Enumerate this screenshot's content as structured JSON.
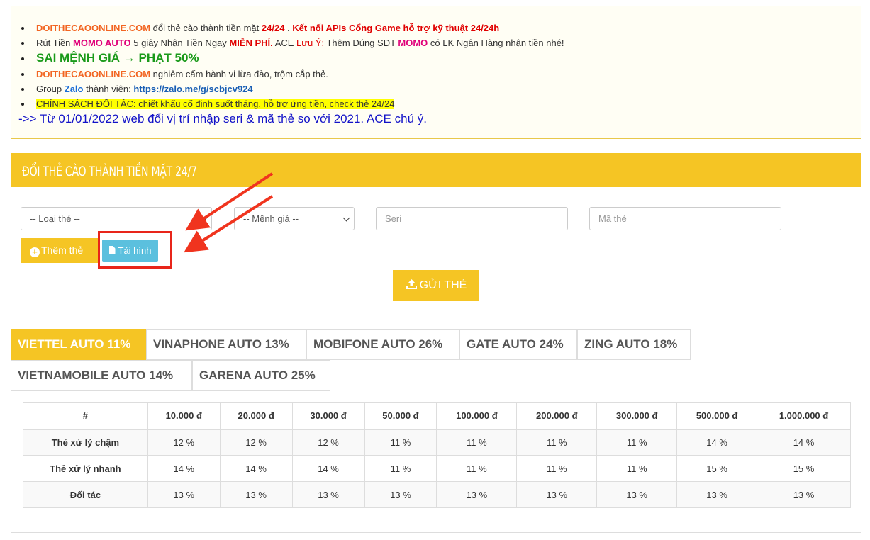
{
  "notice": {
    "line1": {
      "brand": "DOITHECAOONLINE.COM",
      "text1": " đổi thẻ cào thành tiền mặt ",
      "time": "24/24",
      "text2": " . ",
      "apis": "Kết nối APIs Cổng Game hỗ trợ kỹ thuật 24/24h"
    },
    "line2": {
      "text1": "Rút Tiền ",
      "momo": "MOMO AUTO",
      "text2": " 5 giây Nhận Tiền Ngay ",
      "free": "MIỄN PHÍ.",
      "text3": " ACE ",
      "note": "Lưu Ý:",
      "text4": " Thêm Đúng SĐT ",
      "momo2": "MOMO",
      "text5": " có LK Ngân Hàng nhận tiền nhé!"
    },
    "line3": "SAI MỆNH GIÁ → PHẠT 50%",
    "line4": {
      "brand": "DOITHECAOONLINE.COM",
      "text": " nghiêm cấm hành vi lừa đảo, trộm cắp thẻ."
    },
    "line5": {
      "text1": "Group ",
      "zalo": "Zalo",
      "text2": " thành viên: ",
      "link": "https://zalo.me/g/scbjcv924"
    },
    "line6": "CHÍNH SÁCH ĐỐI TÁC: chiết khấu cố định suốt tháng, hỗ trợ ứng tiền, check thẻ 24/24",
    "line7": "->> Từ 01/01/2022 web đổi vị trí nhập seri & mã thẻ so với 2021. ACE chú ý."
  },
  "form": {
    "title": "ĐỔI THẺ CÀO THÀNH TIỀN MẶT 24/7",
    "card_type_placeholder": "-- Loại thẻ --",
    "denomination_placeholder": "-- Mệnh giá --",
    "serial_placeholder": "Seri",
    "code_placeholder": "Mã thẻ",
    "add_label": "Thêm thẻ",
    "upload_label": "Tải hình",
    "send_label": "GỬI THẺ"
  },
  "tabs": [
    {
      "label": "VIETTEL AUTO 11%",
      "active": true
    },
    {
      "label": "VINAPHONE AUTO 13%"
    },
    {
      "label": "MOBIFONE AUTO 26%"
    },
    {
      "label": "GATE AUTO 24%"
    },
    {
      "label": "ZING AUTO 18%"
    },
    {
      "label": "VIETNAMOBILE AUTO 14%"
    },
    {
      "label": "GARENA AUTO 25%"
    }
  ],
  "rate_table": {
    "headers": [
      "#",
      "10.000 đ",
      "20.000 đ",
      "30.000 đ",
      "50.000 đ",
      "100.000 đ",
      "200.000 đ",
      "300.000 đ",
      "500.000 đ",
      "1.000.000 đ"
    ],
    "rows": [
      [
        "Thẻ xử lý chậm",
        "12 %",
        "12 %",
        "12 %",
        "11 %",
        "11 %",
        "11 %",
        "11 %",
        "14 %",
        "14 %"
      ],
      [
        "Thẻ xử lý nhanh",
        "14 %",
        "14 %",
        "14 %",
        "11 %",
        "11 %",
        "11 %",
        "11 %",
        "15 %",
        "15 %"
      ],
      [
        "Đối tác",
        "13 %",
        "13 %",
        "13 %",
        "13 %",
        "13 %",
        "13 %",
        "13 %",
        "13 %",
        "13 %"
      ]
    ]
  },
  "colors": {
    "accent": "#f5c524",
    "upload": "#5bc0de",
    "highlight_box": "#e8251a"
  },
  "icons": {
    "add": "plus-circle-icon",
    "upload": "file-icon",
    "send": "upload-icon",
    "annotation": "red-arrow-icon"
  }
}
